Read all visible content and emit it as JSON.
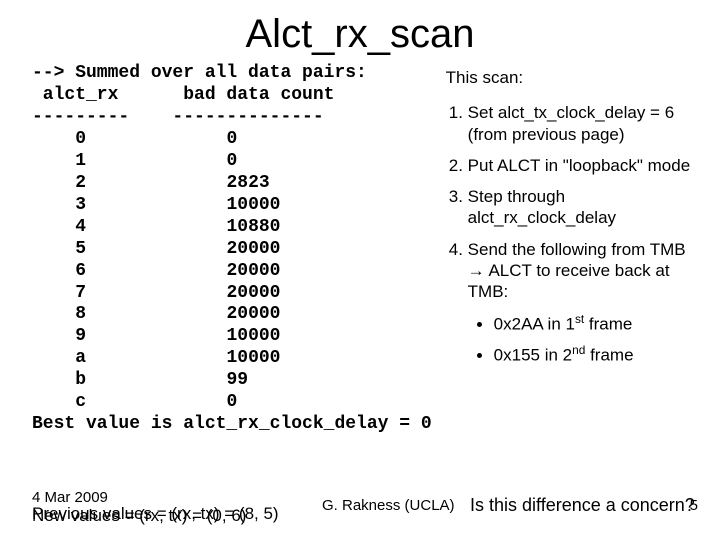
{
  "title": "Alct_rx_scan",
  "table": {
    "header_line1": "--> Summed over all data pairs:",
    "header_line2": " alct_rx      bad data count",
    "header_line3": "---------    --------------",
    "rows": [
      {
        "rx": "0",
        "count": "0"
      },
      {
        "rx": "1",
        "count": "0"
      },
      {
        "rx": "2",
        "count": "2823"
      },
      {
        "rx": "3",
        "count": "10000"
      },
      {
        "rx": "4",
        "count": "10880"
      },
      {
        "rx": "5",
        "count": "20000"
      },
      {
        "rx": "6",
        "count": "20000"
      },
      {
        "rx": "7",
        "count": "20000"
      },
      {
        "rx": "8",
        "count": "20000"
      },
      {
        "rx": "9",
        "count": "10000"
      },
      {
        "rx": "a",
        "count": "10000"
      },
      {
        "rx": "b",
        "count": "99"
      },
      {
        "rx": "c",
        "count": "0"
      }
    ],
    "best_line": "Best value is alct_rx_clock_delay = 0"
  },
  "scan_label": "This scan:",
  "steps": {
    "s1a": "Set alct_tx_clock_delay = 6 (from previous page)",
    "s2": "Put ALCT in \"loopback\" mode",
    "s3": "Step through alct_rx_clock_delay",
    "s4a": "Send the following from TMB ",
    "s4b": " ALCT to receive back at TMB:"
  },
  "arrow": "→",
  "frames": {
    "f1_pre": "0x2AA in 1",
    "f1_sup": "st",
    "f1_post": " frame",
    "f2_pre": "0x155 in 2",
    "f2_sup": "nd",
    "f2_post": " frame"
  },
  "footer": {
    "prev": "Previous values = (rx, tx) = (8, 5)",
    "newv": "New values = (rx, tx) = (0, 6)",
    "date": "4 Mar 2009",
    "author": "G. Rakness (UCLA)",
    "concern": "Is this difference a concern?",
    "page": "5"
  }
}
